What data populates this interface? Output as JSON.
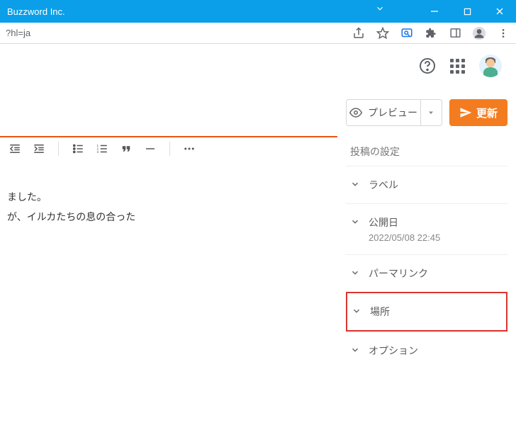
{
  "window": {
    "title": "Buzzword Inc."
  },
  "browser": {
    "url": "?hl=ja"
  },
  "actions": {
    "preview": "プレビュー",
    "update": "更新"
  },
  "editor": {
    "lines": [
      "ました。",
      "が、イルカたちの息の合った"
    ]
  },
  "sidebar": {
    "section_title": "投稿の設定",
    "items": [
      {
        "label": "ラベル",
        "sub": ""
      },
      {
        "label": "公開日",
        "sub": "2022/05/08 22:45"
      },
      {
        "label": "パーマリンク",
        "sub": ""
      },
      {
        "label": "場所",
        "sub": ""
      },
      {
        "label": "オプション",
        "sub": ""
      }
    ]
  }
}
